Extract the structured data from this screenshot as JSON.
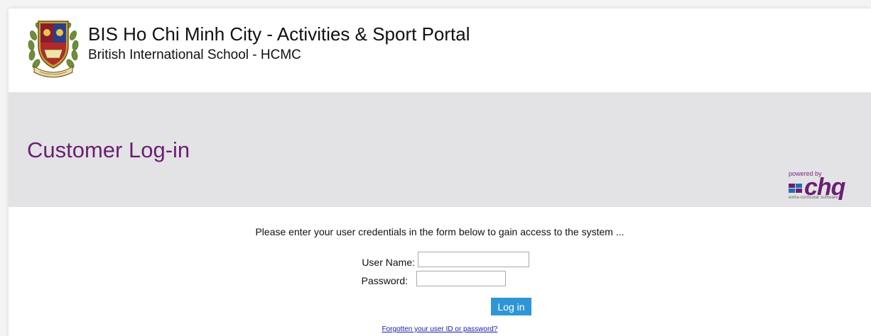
{
  "header": {
    "title": "BIS Ho Chi Minh City - Activities & Sport Portal",
    "subtitle": "British International School - HCMC",
    "logo_icon": "school-crest-logo"
  },
  "page": {
    "title": "Customer Log-in"
  },
  "powered_by": {
    "label": "powered by",
    "brand": "chq",
    "tagline": "extra-curricular software"
  },
  "form": {
    "intro": "Please enter your user credentials in the form below to gain access to the system ...",
    "username_label": "User Name:",
    "username_value": "",
    "password_label": "Password:",
    "password_value": "",
    "login_label": "Log in",
    "forgot_link": "Forgotten your user ID or password?"
  },
  "colors": {
    "title_purple": "#6b1f73",
    "band_grey": "#e3e3e5",
    "button_blue": "#2e96d6",
    "link_blue": "#1a1aa8"
  }
}
